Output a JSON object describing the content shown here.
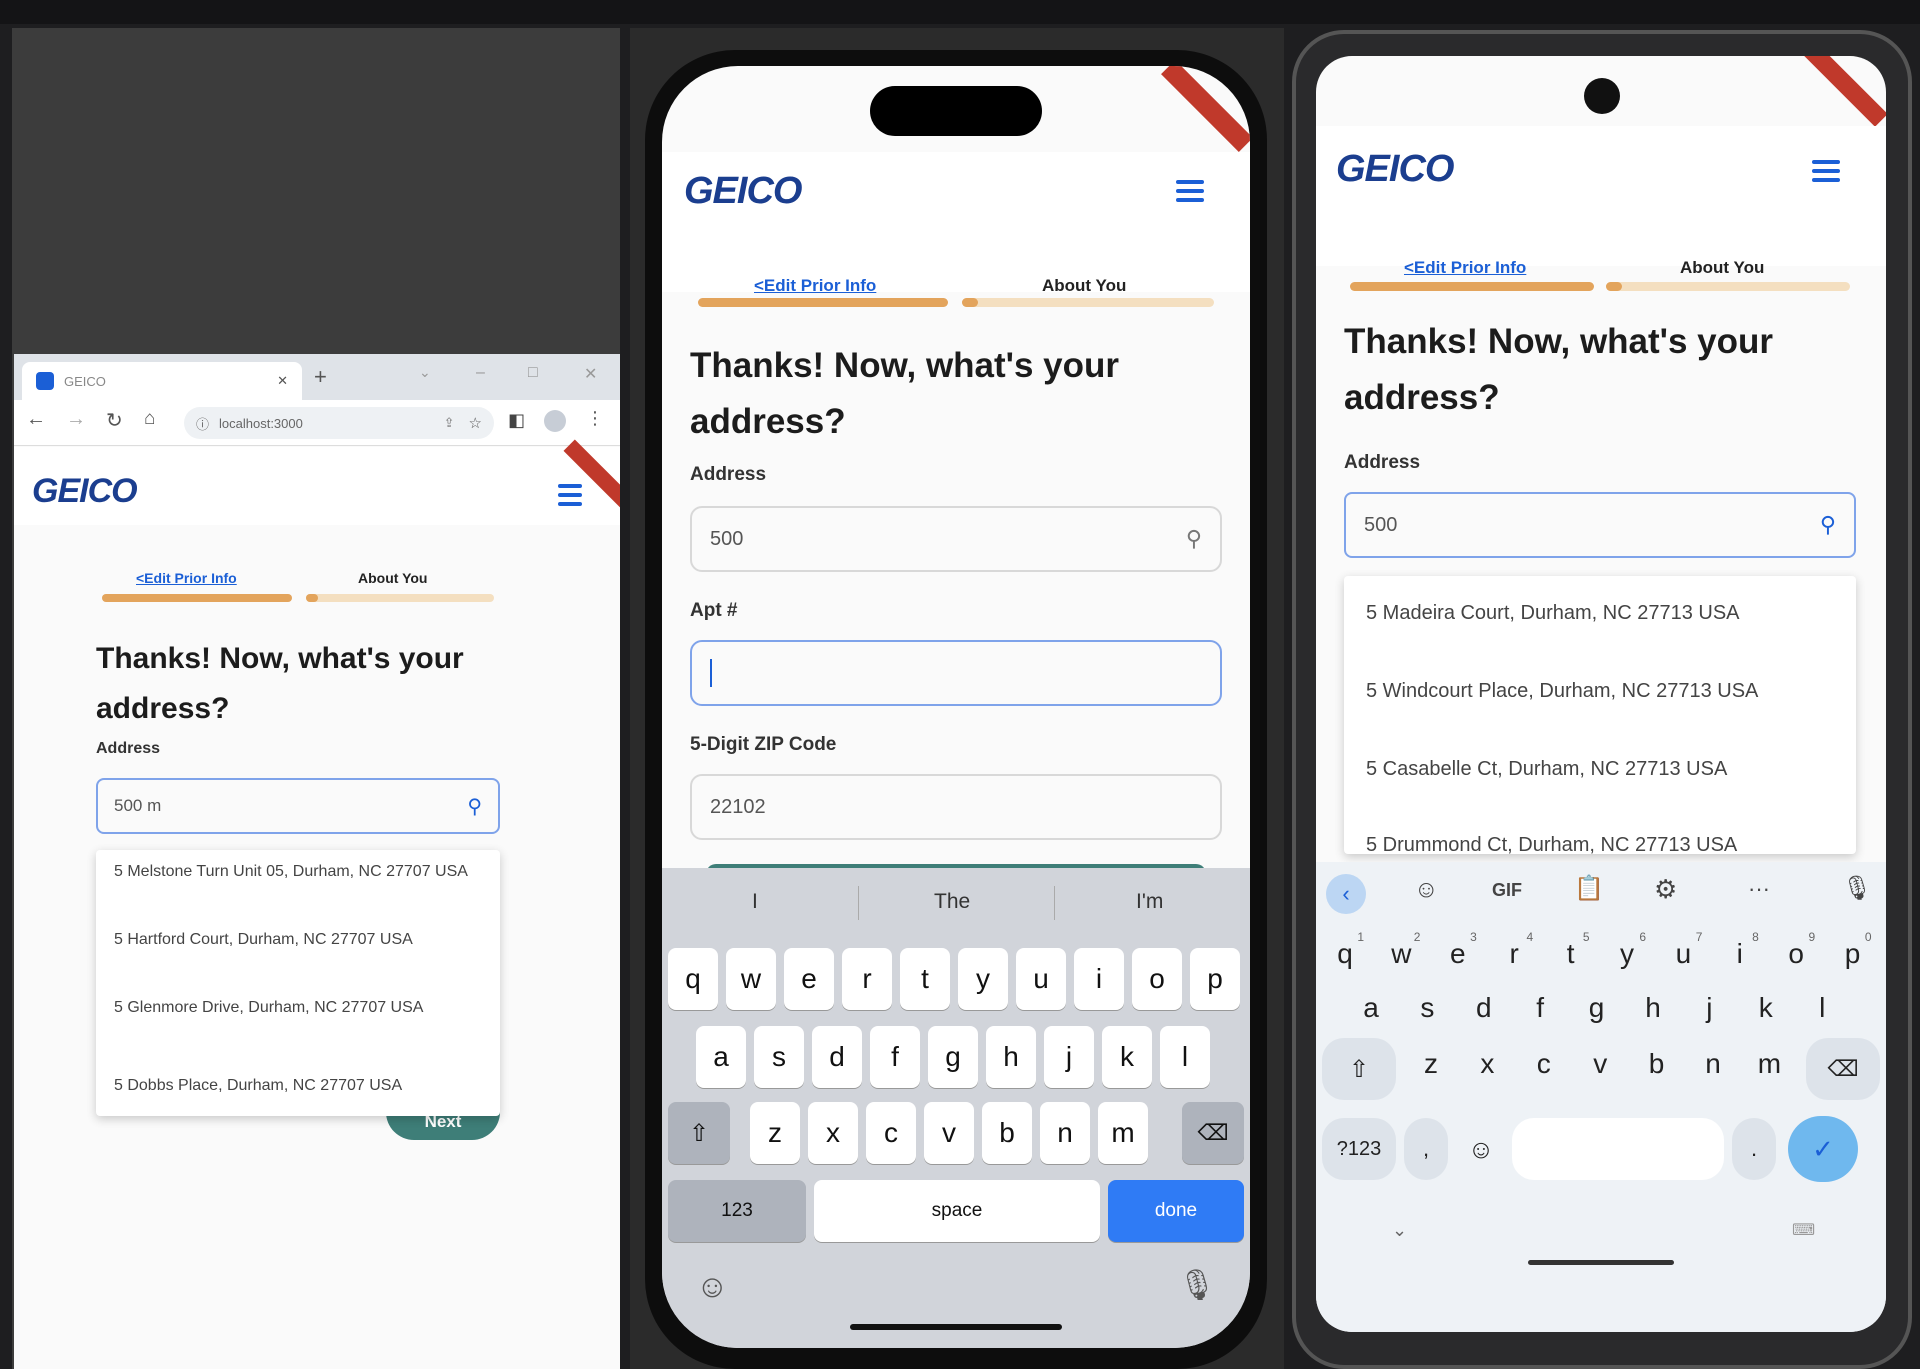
{
  "brand": {
    "logo": "GEICO",
    "accent": "#1b5fd6",
    "progress_color": "#e3a45c",
    "button_color": "#3e7e78"
  },
  "browser": {
    "tab_title": "GEICO",
    "url": "localhost:3000",
    "new_tab": "+",
    "minimize": "–",
    "maximize": "□",
    "close": "✕"
  },
  "tabs": {
    "edit_prior": "<Edit Prior Info",
    "about_you": "About You"
  },
  "heading": "Thanks! Now, what's your address?",
  "labels": {
    "address": "Address",
    "apt": "Apt #",
    "zip": "5-Digit ZIP Code"
  },
  "progress": {
    "step1_fill": 1.0,
    "step2_fill": 0.05
  },
  "web": {
    "address_value": "500 m",
    "suggestions": [
      "5 Melstone Turn Unit 05, Durham, NC 27707 USA",
      "5 Hartford Court, Durham, NC 27707 USA",
      "5 Glenmore Drive, Durham, NC 27707 USA",
      "5 Dobbs Place, Durham, NC 27707 USA"
    ],
    "next_button": "Next"
  },
  "ios": {
    "address_value": "500",
    "apt_value": "",
    "zip_value": "22102",
    "predictions": [
      "I",
      "The",
      "I'm"
    ],
    "rows": [
      [
        "q",
        "w",
        "e",
        "r",
        "t",
        "y",
        "u",
        "i",
        "o",
        "p"
      ],
      [
        "a",
        "s",
        "d",
        "f",
        "g",
        "h",
        "j",
        "k",
        "l"
      ],
      [
        "z",
        "x",
        "c",
        "v",
        "b",
        "n",
        "m"
      ]
    ],
    "key_123": "123",
    "key_space": "space",
    "key_done": "done"
  },
  "android": {
    "address_value": "500",
    "suggestions": [
      "5 Madeira Court, Durham, NC 27713 USA",
      "5 Windcourt Place, Durham, NC 27713 USA",
      "5 Casabelle Ct, Durham, NC 27713 USA",
      "5 Drummond Ct, Durham, NC 27713 USA"
    ],
    "toolbar": {
      "gif": "GIF",
      "more": "···"
    },
    "rows": [
      [
        "q",
        "w",
        "e",
        "r",
        "t",
        "y",
        "u",
        "i",
        "o",
        "p"
      ],
      [
        "a",
        "s",
        "d",
        "f",
        "g",
        "h",
        "j",
        "k",
        "l"
      ],
      [
        "z",
        "x",
        "c",
        "v",
        "b",
        "n",
        "m"
      ]
    ],
    "digits": [
      "1",
      "2",
      "3",
      "4",
      "5",
      "6",
      "7",
      "8",
      "9",
      "0"
    ],
    "key_sym": "?123",
    "key_comma": ",",
    "key_period": "."
  }
}
